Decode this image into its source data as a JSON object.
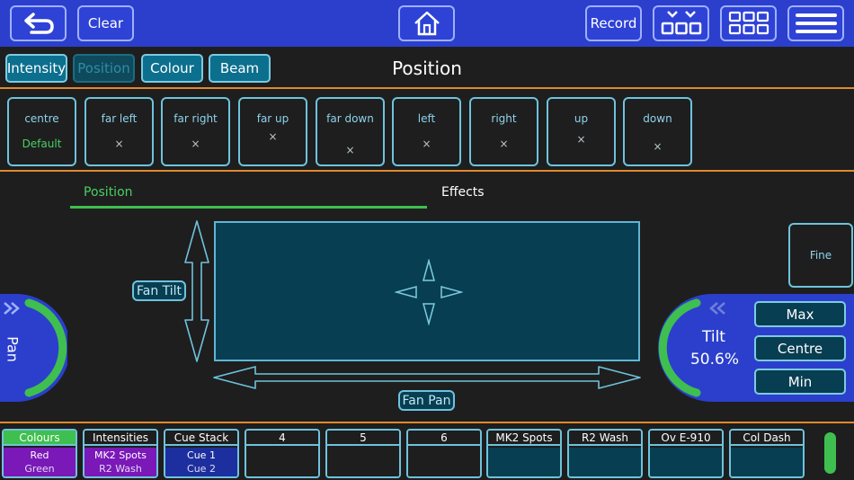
{
  "toolbar": {
    "back_icon": "undo-arrow-icon",
    "clear_label": "Clear",
    "home_icon": "home-icon",
    "record_label": "Record",
    "view_icon": "view-collapse-icon",
    "grid_icon": "grid-icon",
    "menu_icon": "hamburger-menu-icon"
  },
  "modes": [
    "Intensity",
    "Position",
    "Colour",
    "Beam"
  ],
  "active_mode": "Position",
  "page_title": "Position",
  "presets": [
    {
      "label": "centre",
      "value": "Default"
    },
    {
      "label": "far left",
      "value": "×"
    },
    {
      "label": "far right",
      "value": "×"
    },
    {
      "label": "far up",
      "value": "×"
    },
    {
      "label": "far down",
      "value": "×"
    },
    {
      "label": "left",
      "value": "×"
    },
    {
      "label": "right",
      "value": "×"
    },
    {
      "label": "up",
      "value": "×"
    },
    {
      "label": "down",
      "value": "×"
    }
  ],
  "subtabs": {
    "position": "Position",
    "effects": "Effects"
  },
  "xy_pad": {
    "fan_tilt_label": "Fan Tilt",
    "fan_pan_label": "Fan Pan"
  },
  "pan": {
    "label": "Pan"
  },
  "tilt": {
    "label": "Tilt",
    "value": "50.6%",
    "level": 0.506
  },
  "fine_label": "Fine",
  "tilt_buttons": {
    "max": "Max",
    "centre": "Centre",
    "min": "Min"
  },
  "playbacks": [
    {
      "title": "Colours",
      "line1": "Red",
      "line2": "Green",
      "color": "#7a18b8",
      "header_color": "#3fbf4f"
    },
    {
      "title": "Intensities",
      "line1": "MK2 Spots",
      "line2": "R2 Wash",
      "color": "#7a18b8",
      "header_color": "#1e1e1f"
    },
    {
      "title": "Cue Stack",
      "line1": "Cue 1",
      "line2": "Cue 2",
      "color": "#1d2f9e",
      "header_color": "#1e1e1f"
    },
    {
      "title": "4",
      "line1": "",
      "line2": "",
      "color": "#1e1e1f",
      "header_color": "#1e1e1f"
    },
    {
      "title": "5",
      "line1": "",
      "line2": "",
      "color": "#1e1e1f",
      "header_color": "#1e1e1f"
    },
    {
      "title": "6",
      "line1": "",
      "line2": "",
      "color": "#1e1e1f",
      "header_color": "#1e1e1f"
    },
    {
      "title": "MK2 Spots",
      "line1": "",
      "line2": "",
      "color": "#083e52",
      "header_color": "#1e1e1f"
    },
    {
      "title": "R2 Wash",
      "line1": "",
      "line2": "",
      "color": "#083e52",
      "header_color": "#1e1e1f"
    },
    {
      "title": "Ov E-910",
      "line1": "",
      "line2": "",
      "color": "#083e52",
      "header_color": "#1e1e1f"
    },
    {
      "title": "Col Dash",
      "line1": "",
      "line2": "",
      "color": "#083e52",
      "header_color": "#1e1e1f"
    }
  ],
  "colors": {
    "topbar": "#2b3fcc",
    "accent_green": "#3fbf4f",
    "accent_orange": "#e08a2a",
    "cyan_border": "#6ec3dc"
  }
}
